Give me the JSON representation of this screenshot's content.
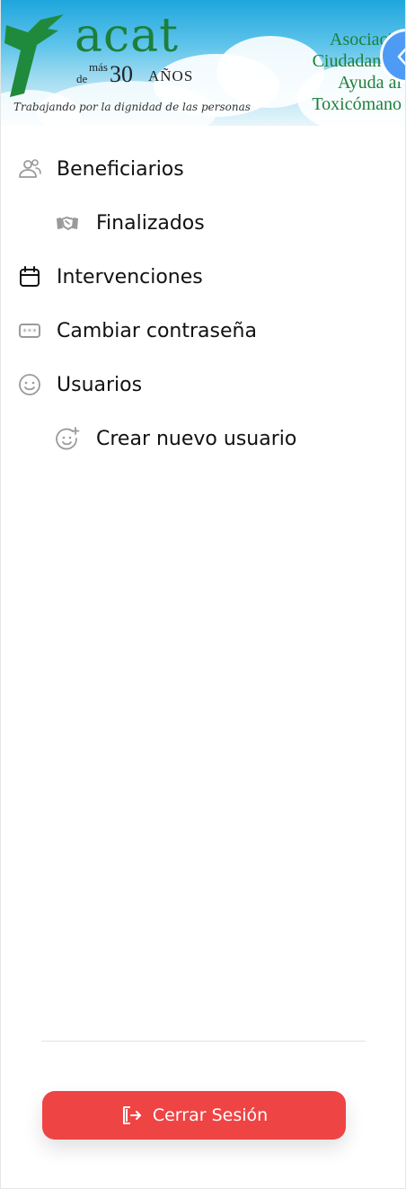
{
  "banner": {
    "logo_word": "acat",
    "logo_mas": "más",
    "logo_de": "de",
    "logo_years": "30",
    "logo_anos": "AÑOS",
    "tagline": "Trabajando por la dignidad de las personas",
    "org_lines": [
      "Asociació",
      "Ciudadana c",
      "Ayuda al",
      "Toxicómano"
    ]
  },
  "menu": {
    "items": [
      {
        "label": "Beneficiarios",
        "icon": "users-icon"
      },
      {
        "label": "Finalizados",
        "icon": "handshake-icon"
      },
      {
        "label": "Intervenciones",
        "icon": "calendar-icon"
      },
      {
        "label": "Cambiar contraseña",
        "icon": "password-icon"
      },
      {
        "label": "Usuarios",
        "icon": "smile-icon"
      },
      {
        "label": "Crear nuevo usuario",
        "icon": "smile-plus-icon"
      }
    ]
  },
  "footer": {
    "logout_label": "Cerrar Sesión"
  },
  "colors": {
    "accent": "#4e9bf5",
    "danger": "#ef4444",
    "logo_green": "#1d7f3a",
    "icon_gray": "#9a9a9a"
  }
}
